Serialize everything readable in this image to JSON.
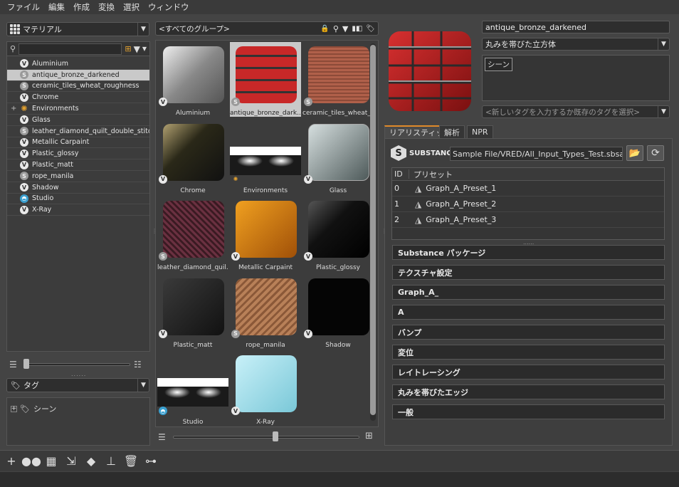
{
  "menu": [
    "ファイル",
    "編集",
    "作成",
    "変換",
    "選択",
    "ウィンドウ"
  ],
  "left": {
    "type_combo": "マテリアル",
    "search_placeholder": "",
    "tree": [
      {
        "label": "Aluminium",
        "icon": "v"
      },
      {
        "label": "antique_bronze_darkened",
        "icon": "s",
        "selected": true
      },
      {
        "label": "ceramic_tiles_wheat_roughness",
        "icon": "s"
      },
      {
        "label": "Chrome",
        "icon": "v"
      },
      {
        "label": "Environments",
        "icon": "env",
        "expandable": true
      },
      {
        "label": "Glass",
        "icon": "v"
      },
      {
        "label": "leather_diamond_quilt_double_stitch",
        "icon": "s"
      },
      {
        "label": "Metallic Carpaint",
        "icon": "v"
      },
      {
        "label": "Plastic_glossy",
        "icon": "v"
      },
      {
        "label": "Plastic_matt",
        "icon": "v"
      },
      {
        "label": "rope_manila",
        "icon": "s"
      },
      {
        "label": "Shadow",
        "icon": "v"
      },
      {
        "label": "Studio",
        "icon": "st"
      },
      {
        "label": "X-Ray",
        "icon": "v"
      }
    ],
    "tag_combo": "タグ",
    "tag_tree": [
      "シーン"
    ]
  },
  "middle": {
    "group_combo": "<すべてのグループ>",
    "thumbs": [
      {
        "label": "Aluminium",
        "badge": "v",
        "kind": "aluminium"
      },
      {
        "label": "antique_bronze_dark...",
        "badge": "s",
        "kind": "bronze",
        "selected": true
      },
      {
        "label": "ceramic_tiles_wheat_r...",
        "badge": "s",
        "kind": "tiles"
      },
      {
        "label": "Chrome",
        "badge": "v",
        "kind": "chrome"
      },
      {
        "label": "Environments",
        "badge": "env",
        "kind": "env"
      },
      {
        "label": "Glass",
        "badge": "v",
        "kind": "glass"
      },
      {
        "label": "leather_diamond_quil...",
        "badge": "s",
        "kind": "leather"
      },
      {
        "label": "Metallic Carpaint",
        "badge": "v",
        "kind": "carpaint"
      },
      {
        "label": "Plastic_glossy",
        "badge": "v",
        "kind": "glossy"
      },
      {
        "label": "Plastic_matt",
        "badge": "v",
        "kind": "matt"
      },
      {
        "label": "rope_manila",
        "badge": "s",
        "kind": "rope"
      },
      {
        "label": "Shadow",
        "badge": "v",
        "kind": "shadow"
      },
      {
        "label": "Studio",
        "badge": "st",
        "kind": "studio"
      },
      {
        "label": "X-Ray",
        "badge": "v",
        "kind": "xray"
      }
    ]
  },
  "right": {
    "name": "antique_bronze_darkened",
    "geometry": "丸みを帯びた立方体",
    "tags": [
      "シーン"
    ],
    "tag_placeholder": "<新しいタグを入力するか既存のタグを選択>",
    "tabs": [
      "リアリスティック",
      "解析",
      "NPR"
    ],
    "substance_logo": "SUBSTANCE",
    "file_path": "Sample File/VRED/All_Input_Types_Test.sbsar",
    "preset_header": {
      "id": "ID",
      "name": "プリセット"
    },
    "presets": [
      {
        "id": "0",
        "name": "Graph_A_Preset_1"
      },
      {
        "id": "1",
        "name": "Graph_A_Preset_2"
      },
      {
        "id": "2",
        "name": "Graph_A_Preset_3"
      }
    ],
    "sections": [
      "Substance パッケージ",
      "テクスチャ設定",
      "Graph_A_",
      "A",
      "バンプ",
      "変位",
      "レイトレーシング",
      "丸みを帯びたエッジ",
      "一般"
    ]
  },
  "colors": {
    "accent": "#e08a2a",
    "selection": "#c9c9c9"
  }
}
